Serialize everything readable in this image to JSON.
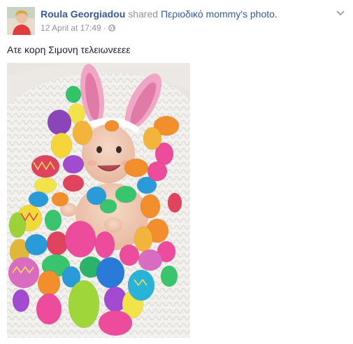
{
  "post": {
    "author": "Roula Georgiadou",
    "shared_word": "shared",
    "shared_link": "Περιοδικό mommy's photo.",
    "timestamp": "12 April at 17:49",
    "separator": "·",
    "privacy_icon": "globe-icon",
    "options_icon": "chevron-down-icon",
    "text": "Ατε κορη Σιμονη τελειωνεεεε"
  },
  "colors": {
    "link": "#365899",
    "meta": "#90949c",
    "text": "#1d2129"
  }
}
